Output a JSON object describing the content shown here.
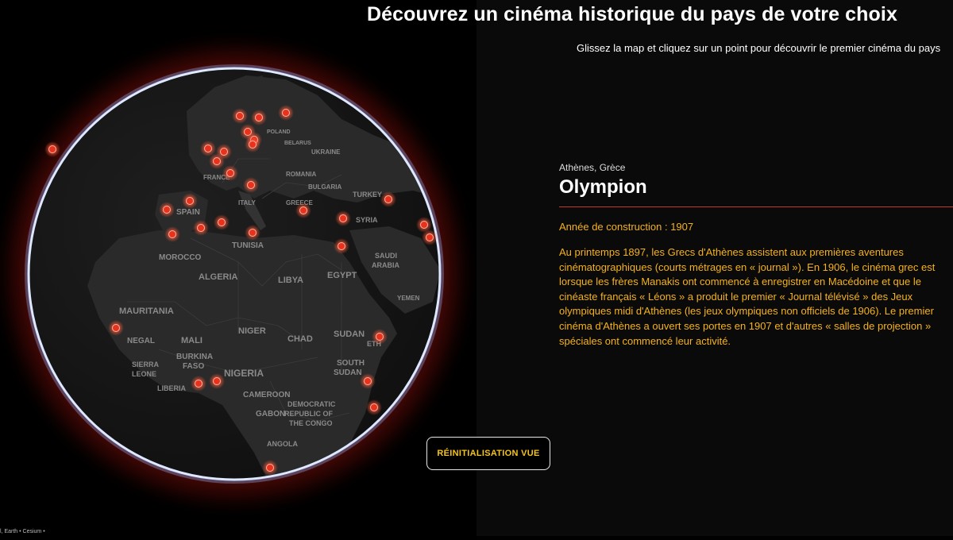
{
  "header": {
    "title": "Découvrez un cinéma historique du pays de votre choix",
    "subtitle": "Glissez la map et cliquez sur un point pour découvrir le premier cinéma du pays"
  },
  "map": {
    "labels": {
      "spain": "SPAIN",
      "morocco": "MOROCCO",
      "tunisia": "TUNISIA",
      "algeria": "ALGERIA",
      "libya": "LIBYA",
      "egypt": "EGYPT",
      "mauritania": "MAURITANIA",
      "mali": "MALI",
      "niger": "NIGER",
      "chad": "CHAD",
      "sudan": "SUDAN",
      "burkina": "BURKINA",
      "faso": "FASO",
      "nigeria": "NIGERIA",
      "cameroon": "CAMEROON",
      "south": "SOUTH",
      "sudan2": "SUDAN",
      "sierra": "SIERRA",
      "leone": "LEONE",
      "liberia": "LIBERIA",
      "senegal": "NEGAL",
      "gabon": "GABON",
      "democratic": "DEMOCRATIC",
      "republic_of": "REPUBLIC OF",
      "the_congo": "THE CONGO",
      "angola": "ANGOLA",
      "turkey": "TURKEY",
      "syria": "SYRIA",
      "saudi": "SAUDI",
      "arabia": "ARABIA",
      "yemen": "YEMEN",
      "romania": "ROMANIA",
      "bulgaria": "BULGARIA",
      "france": "FRANCE",
      "poland": "POLAND",
      "ukraine": "UKRAINE",
      "belarus": "BELARUS",
      "greece": "GREECE",
      "italy": "ITALY",
      "etal": "ETH"
    }
  },
  "detail": {
    "location": "Athènes, Grèce",
    "cinema_name": "Olympion",
    "year_line": "Année de construction : 1907",
    "description": "Au printemps 1897, les Grecs d'Athènes assistent aux premières aventures cinématographiques (courts métrages en « journal »). En 1906, le cinéma grec est lorsque les frères Manakis ont commencé à enregistrer en Macédoine et que le cinéaste français « Léons » a produit le premier « Journal télévisé » des Jeux olympiques midi d'Athènes (les jeux olympiques non officiels de 1906). Le premier cinéma d'Athènes a ouvert ses portes en 1907 et d'autres « salles de projection » spéciales ont commencé leur activité."
  },
  "controls": {
    "reset_label": "RÉINITIALISATION VUE"
  },
  "footer": {
    "attribution": "l, Earth • Cesium •"
  },
  "colors": {
    "marker": "#e8321e",
    "accent": "#f5b21a",
    "divider": "#c0392b",
    "globe_rim": "#dfe9ff"
  }
}
